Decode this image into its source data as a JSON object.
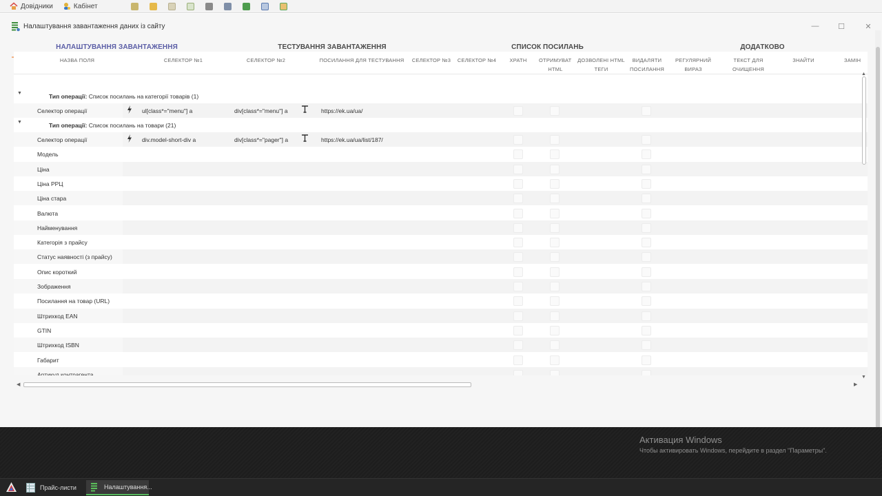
{
  "topbar": {
    "menu": [
      {
        "label": "Довідники",
        "icon": "home-icon"
      },
      {
        "label": "Кабінет",
        "icon": "user-key-icon"
      }
    ],
    "tools": [
      "edit-icon",
      "folder-icon",
      "document-icon",
      "calendar-icon",
      "chart-icon",
      "book-icon",
      "list-icon",
      "add-document-icon",
      "grid-icon"
    ]
  },
  "window": {
    "title": "Налаштування завантаження даних із сайту",
    "controls": {
      "minimize": "—",
      "maximize": "☐",
      "close": "✕"
    }
  },
  "tabs": [
    {
      "label": "НАЛАШТУВАННЯ ЗАВАНТАЖЕННЯ",
      "active": true
    },
    {
      "label": "ТЕСТУВАННЯ ЗАВАНТАЖЕННЯ",
      "active": false
    },
    {
      "label": "СПИСОК ПОСИЛАНЬ",
      "active": false
    },
    {
      "label": "ДОДАТКОВО",
      "active": false
    }
  ],
  "grid": {
    "columns": [
      {
        "l1": "НАЗВА ПОЛЯ",
        "l2": ""
      },
      {
        "l1": "СЕЛЕКТОР №1",
        "l2": ""
      },
      {
        "l1": "СЕЛЕКТОР №2",
        "l2": ""
      },
      {
        "l1": "ПОСИЛАННЯ ДЛЯ ТЕСТУВАННЯ",
        "l2": ""
      },
      {
        "l1": "СЕЛЕКТОР №3",
        "l2": ""
      },
      {
        "l1": "СЕЛЕКТОР №4",
        "l2": ""
      },
      {
        "l1": "ХРАТН",
        "l2": ""
      },
      {
        "l1": "ОТРИМУВАТИ",
        "l2": "HTML"
      },
      {
        "l1": "ДОЗВОЛЕНІ HTML",
        "l2": "ТЕГИ"
      },
      {
        "l1": "ВИДАЛЯТИ",
        "l2": "ПОСИЛАННЯ"
      },
      {
        "l1": "РЕГУЛЯРНИЙ",
        "l2": "ВИРАЗ"
      },
      {
        "l1": "ТЕКСТ ДЛЯ",
        "l2": "ОЧИЩЕННЯ"
      },
      {
        "l1": "ЗНАЙТИ",
        "l2": ""
      },
      {
        "l1": "ЗАМІН",
        "l2": ""
      }
    ],
    "groups": [
      {
        "label": "Тип операції:",
        "value": "Список посилань на категорії товарів (1)",
        "rows": [
          {
            "name": "Селектор операції",
            "selector1": "ul[class*=\"menu\"] a",
            "selector2": "div[class*=\"menu\"] a",
            "test_url": "https://ek.ua/ua/"
          }
        ]
      },
      {
        "label": "Тип операції:",
        "value": "Список посилань на товари (21)",
        "rows": [
          {
            "name": "Селектор операції",
            "selector1": "div.model-short-div a",
            "selector2": "div[class*=\"pager\"] a",
            "test_url": "https://ek.ua/ua/list/187/"
          },
          {
            "name": "Модель"
          },
          {
            "name": "Ціна"
          },
          {
            "name": "Ціна РРЦ"
          },
          {
            "name": "Ціна стара"
          },
          {
            "name": "Валюта"
          },
          {
            "name": "Найменування"
          },
          {
            "name": "Категорія з прайсу"
          },
          {
            "name": "Статус наявності (з прайсу)"
          },
          {
            "name": "Опис короткий"
          },
          {
            "name": "Зображення"
          },
          {
            "name": "Посилання на товар (URL)"
          },
          {
            "name": "Штрихкод EAN"
          },
          {
            "name": "GTIN"
          },
          {
            "name": "Штрихкод ISBN"
          },
          {
            "name": "Габарит"
          },
          {
            "name": "Артикул контрагента"
          }
        ]
      }
    ]
  },
  "activation": {
    "title": "Активация Windows",
    "subtitle": "Чтобы активировать Windows, перейдите в раздел \"Параметры\"."
  },
  "taskbar": {
    "tasks": [
      {
        "label": "Прайс-листи",
        "active": false
      },
      {
        "label": "Налаштування...",
        "active": true
      }
    ]
  },
  "colors": {
    "accent_tab": "#5b5ea6",
    "tab_underline": "#f2b183",
    "taskbar_active": "#56b85d"
  }
}
